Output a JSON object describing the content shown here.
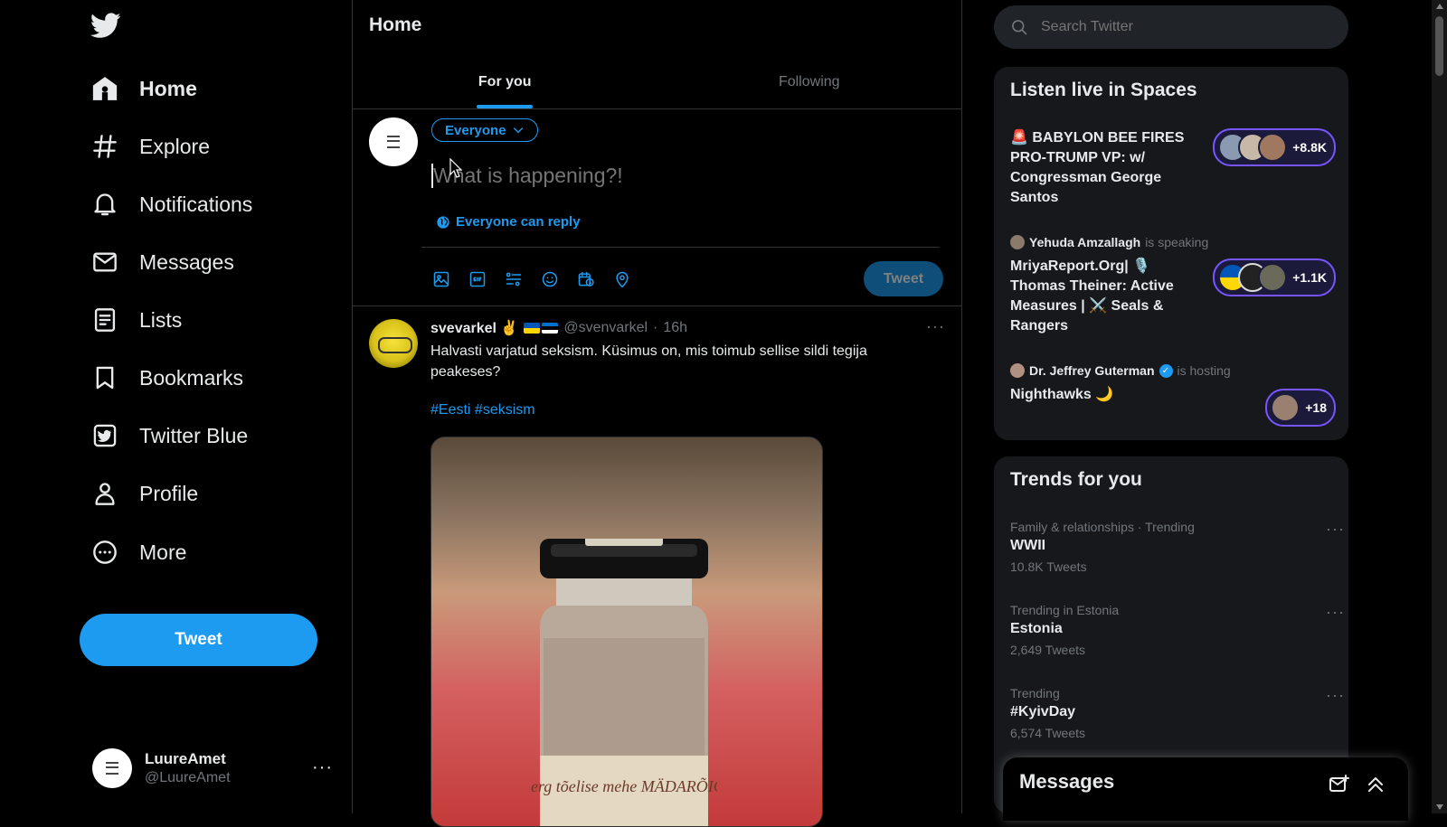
{
  "nav": {
    "items": [
      {
        "label": "Home",
        "icon": "home-icon"
      },
      {
        "label": "Explore",
        "icon": "hashtag-icon"
      },
      {
        "label": "Notifications",
        "icon": "bell-icon"
      },
      {
        "label": "Messages",
        "icon": "mail-icon"
      },
      {
        "label": "Lists",
        "icon": "list-icon"
      },
      {
        "label": "Bookmarks",
        "icon": "bookmark-icon"
      },
      {
        "label": "Twitter Blue",
        "icon": "twitter-blue-icon"
      },
      {
        "label": "Profile",
        "icon": "person-icon"
      },
      {
        "label": "More",
        "icon": "more-circle-icon"
      }
    ],
    "tweet_label": "Tweet"
  },
  "account": {
    "name": "LuureAmet",
    "handle": "@LuureAmet"
  },
  "main": {
    "title": "Home",
    "tabs": [
      {
        "label": "For you"
      },
      {
        "label": "Following"
      }
    ],
    "composer": {
      "audience": "Everyone",
      "placeholder": "What is happening?!",
      "reply_setting": "Everyone can reply",
      "tweet_label": "Tweet"
    },
    "tweet": {
      "name": "svevarkel ✌",
      "handle": "@svenvarkel",
      "time": "16h",
      "text": "Halvasti varjatud seksism. Küsimus on, mis toimub sellise sildi tegija peakeses?",
      "hashtags": "#Eesti #seksism",
      "image_label": "Viiberg tõelise mehe MÄDARÕIGAS"
    }
  },
  "right": {
    "search_placeholder": "Search Twitter",
    "spaces": {
      "title": "Listen live in Spaces",
      "items": [
        {
          "host": "",
          "status": "",
          "title": "🚨 BABYLON BEE FIRES PRO-TRUMP VP: w/ Congressman George Santos",
          "count": "+8.8K"
        },
        {
          "host": "Yehuda Amzallagh",
          "status": "is speaking",
          "title": "MriyaReport.Org| 🎙️ Thomas Theiner: Active Measures | ⚔️ Seals & Rangers",
          "count": "+1.1K"
        },
        {
          "host": "Dr. Jeffrey Guterman",
          "status": "is hosting",
          "title": "Nighthawks 🌙",
          "count": "+18"
        }
      ]
    },
    "trends": {
      "title": "Trends for you",
      "items": [
        {
          "category": "Family & relationships · Trending",
          "name": "WWII",
          "count": "10.8K Tweets"
        },
        {
          "category": "Trending in Estonia",
          "name": "Estonia",
          "count": "2,649 Tweets"
        },
        {
          "category": "Trending",
          "name": "#KyivDay",
          "count": "6,574 Tweets"
        }
      ]
    },
    "messages_drawer": {
      "title": "Messages"
    }
  },
  "colors": {
    "accent": "#1d9bf0",
    "background": "#000000",
    "card": "#16181c",
    "spaces_purple": "#7856ff"
  }
}
